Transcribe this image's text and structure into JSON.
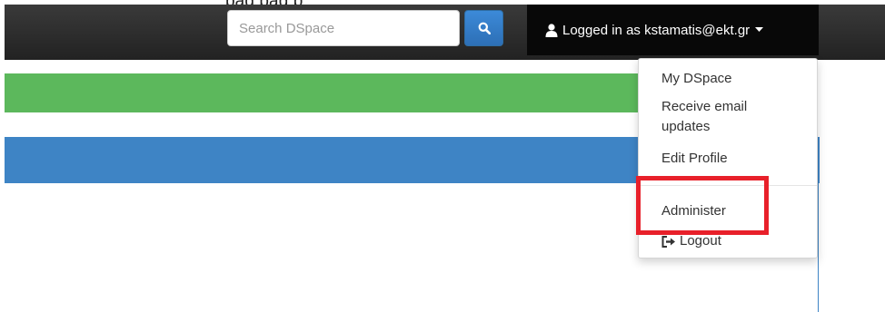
{
  "caption": {
    "text": "pag    pag    p"
  },
  "navbar": {
    "search": {
      "placeholder": "Search DSpace",
      "value": "",
      "button_icon": "search-icon"
    },
    "user": {
      "label": "Logged in as kstamatis@ekt.gr",
      "icon": "user-icon",
      "caret_icon": "caret-down-icon"
    }
  },
  "dropdown": {
    "items": [
      {
        "label": "My DSpace"
      },
      {
        "label": "Receive email updates"
      },
      {
        "label": "Edit Profile"
      },
      {
        "label": "Administer",
        "highlighted": true
      },
      {
        "label": "Logout",
        "icon": "logout-icon"
      }
    ]
  },
  "colors": {
    "navbar": "#222222",
    "success_bar": "#5cb85c",
    "primary_bar": "#3e84c5",
    "highlight": "#e8202a"
  }
}
